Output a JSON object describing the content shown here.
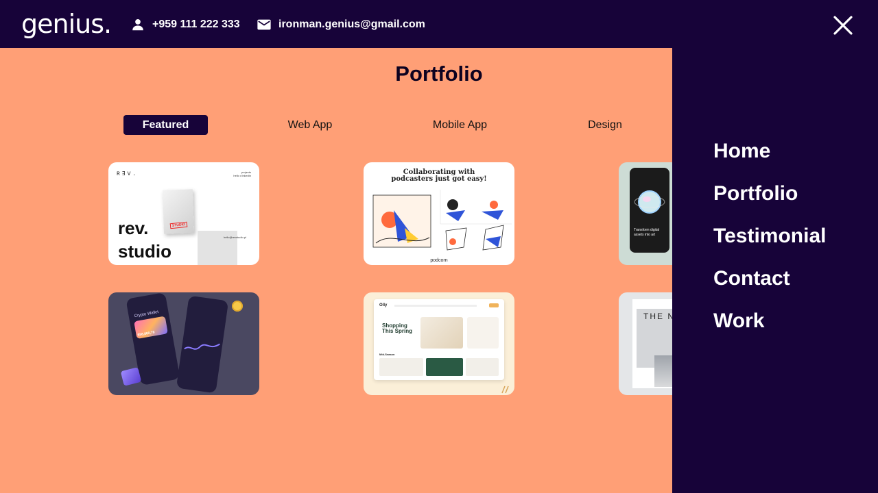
{
  "header": {
    "logo": "genius.",
    "phone": "+959 111 222 333",
    "email": "ironman.genius@gmail.com"
  },
  "portfolio": {
    "title": "Portfolio",
    "tabs": [
      {
        "label": "Featured",
        "active": true
      },
      {
        "label": "Web App",
        "active": false
      },
      {
        "label": "Mobile App",
        "active": false
      },
      {
        "label": "Design",
        "active": false
      }
    ],
    "cards": [
      {
        "brand": "R∃V.",
        "headline_1": "rev.",
        "headline_2": "studio",
        "email_text": "hello@revstudio.pl",
        "side_text": "projects\nhello • linkedin",
        "stamp": "STUDIO"
      },
      {
        "headline_1": "Collaborating with",
        "headline_2": "podcasters just got easy!",
        "brand": "podcorn"
      },
      {
        "caption": "Transform digital assets into art"
      },
      {
        "headline": "Crypto Wallet",
        "amount": "$58,860,78"
      },
      {
        "brand": "Olly",
        "headline_1": "Shopping",
        "headline_2": "This Spring",
        "section": "Mid-Season"
      },
      {
        "headline": "THE N"
      }
    ]
  },
  "menu": {
    "items": [
      "Home",
      "Portfolio",
      "Testimonial",
      "Contact",
      "Work"
    ]
  },
  "colors": {
    "navy": "#170339",
    "peach": "#ff9f76",
    "white": "#ffffff"
  }
}
